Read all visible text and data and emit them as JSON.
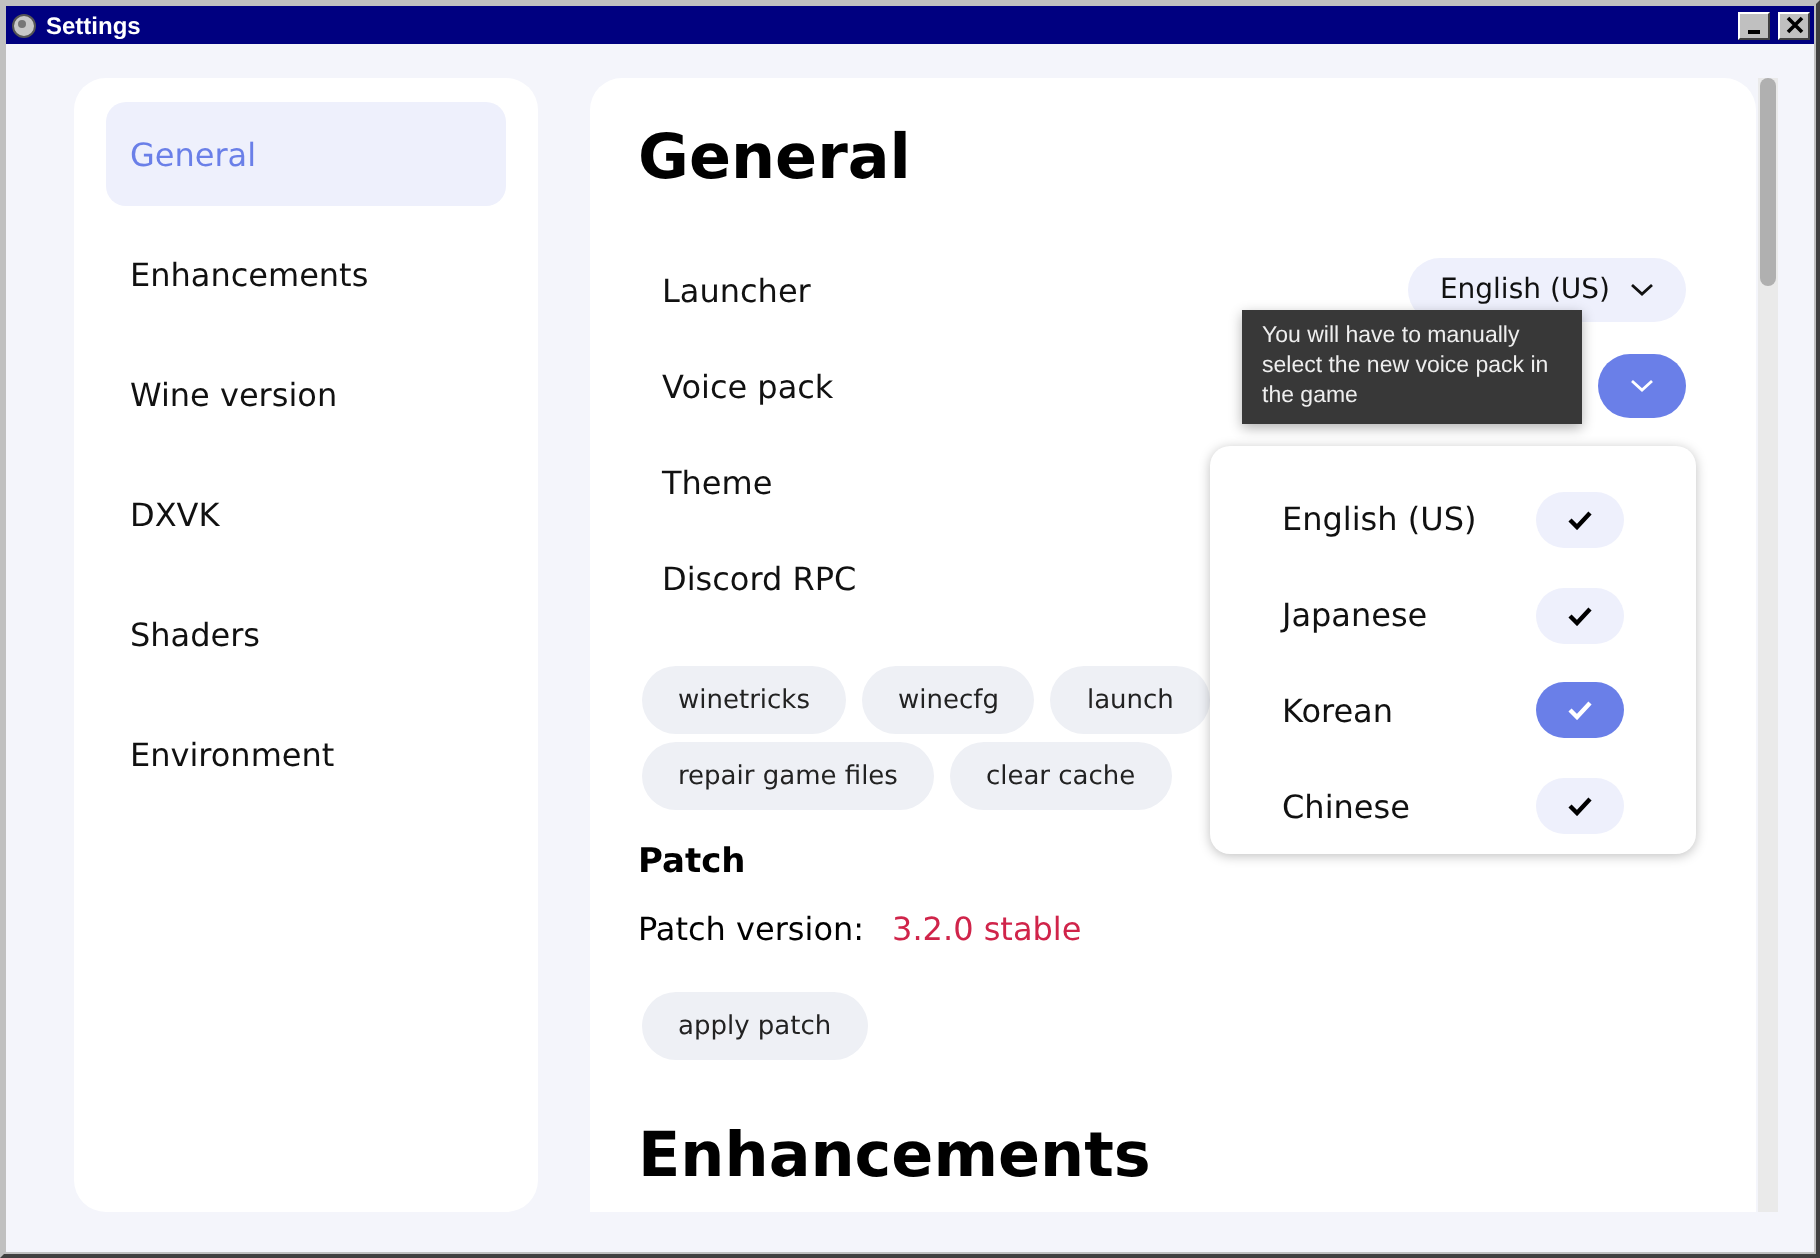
{
  "window": {
    "title": "Settings"
  },
  "sidebar": {
    "items": [
      {
        "label": "General",
        "selected": true
      },
      {
        "label": "Enhancements",
        "selected": false
      },
      {
        "label": "Wine version",
        "selected": false
      },
      {
        "label": "DXVK",
        "selected": false
      },
      {
        "label": "Shaders",
        "selected": false
      },
      {
        "label": "Environment",
        "selected": false
      }
    ]
  },
  "section_title": "General",
  "settings": [
    {
      "label": "Launcher",
      "control": {
        "value": "English (US)",
        "expanded": false
      }
    },
    {
      "label": "Voice pack",
      "control": {
        "expanded": true
      }
    },
    {
      "label": "Theme"
    },
    {
      "label": "Discord RPC"
    }
  ],
  "tooltip": {
    "text": "You will have to manually select the new voice pack in the game"
  },
  "dropdown": {
    "options": [
      {
        "label": "English (US)",
        "selected": false
      },
      {
        "label": "Japanese",
        "selected": false
      },
      {
        "label": "Korean",
        "selected": true
      },
      {
        "label": "Chinese",
        "selected": false
      }
    ]
  },
  "tool_buttons": [
    [
      "winetricks",
      "winecfg",
      "launch"
    ],
    [
      "repair game files",
      "clear cache"
    ]
  ],
  "patch": {
    "title": "Patch",
    "version_label": "Patch version:",
    "version_value": "3.2.0 stable",
    "button": "apply patch"
  },
  "next_section_title": "Enhancements"
}
